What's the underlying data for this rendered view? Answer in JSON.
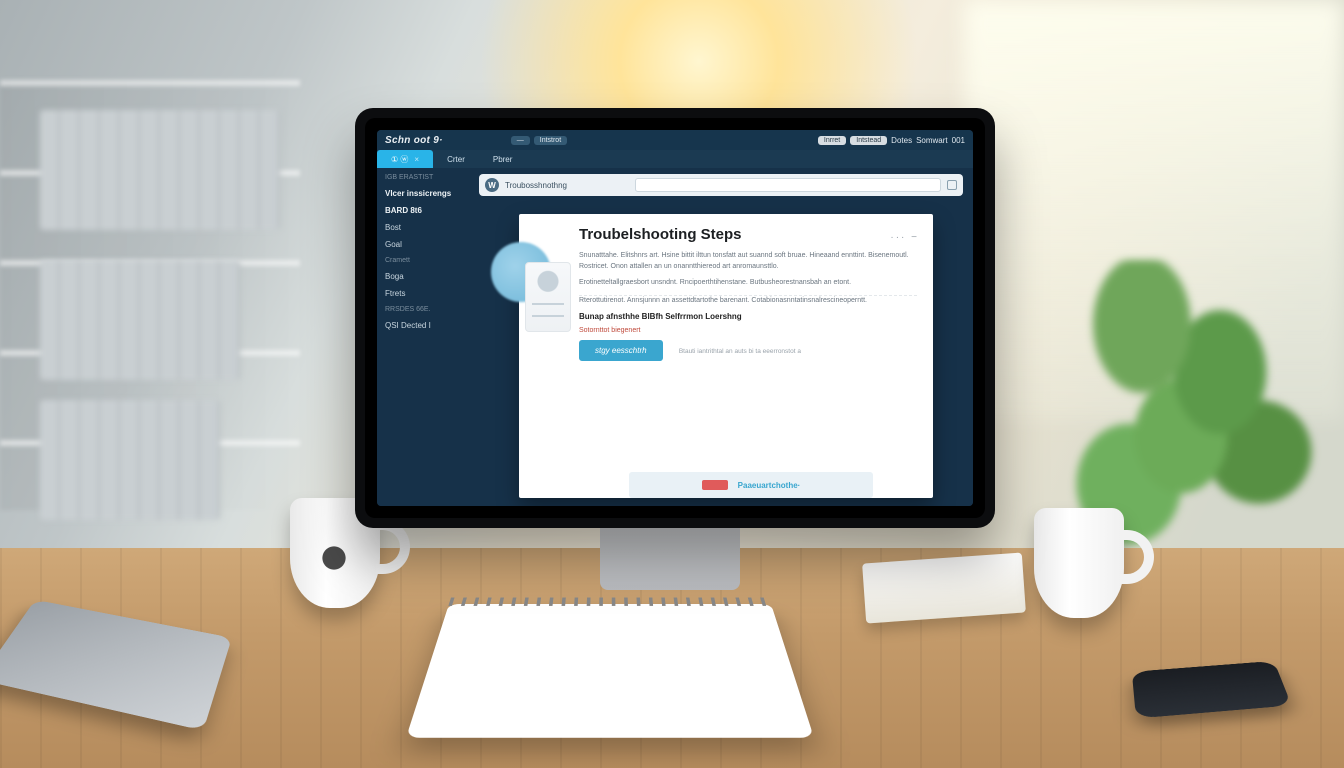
{
  "header": {
    "brand": "Schn oot 9·",
    "chips": [
      "—",
      "Intstrot"
    ],
    "right_pills": [
      "Inrret",
      "Intstead"
    ],
    "right_links": [
      "Dotes",
      "Somwart",
      "001"
    ]
  },
  "tabs": [
    {
      "label": "① ⓦ",
      "active": true
    },
    {
      "label": "Crter",
      "active": false
    },
    {
      "label": "Pbrer",
      "active": false
    }
  ],
  "sidebar": {
    "items": [
      {
        "label": "IGB ERASTIST",
        "variant": "dim"
      },
      {
        "label": "Vlcer inssicrengs",
        "variant": "strong"
      },
      {
        "label": "BARD 8t6",
        "variant": "strong"
      },
      {
        "label": "Bost",
        "variant": ""
      },
      {
        "label": "Goal",
        "variant": ""
      },
      {
        "label": "Cramett",
        "variant": "dim"
      },
      {
        "label": "Boga",
        "variant": ""
      },
      {
        "label": "Ftrets",
        "variant": ""
      },
      {
        "label": "RRSDES 66E.",
        "variant": "dim"
      },
      {
        "label": "QSI Dected I",
        "variant": ""
      }
    ]
  },
  "urlbar": {
    "icon_text": "W",
    "path": "Troubosshnothng",
    "placeholder": ""
  },
  "article": {
    "title": "Troubelshooting Steps",
    "more": "···  −",
    "p1": "Snunatttahe. Elitshnrs art. Hsine bittit ilttun tonsfatt aut suannd soft bruae. Hineaand ennttint. Bisenemoutl. Rostricet. Onon attallen an un onanntthiereod art anromaunsttlo.",
    "p2": "Erotinetteltallgraesbort unsndnt. Rncipoerthtihenstane. Butbusheorestnansbah an etont.",
    "p3": "Rterottutirenot. Annsjunnn an assettdtartothe barenant. Cotabionasnntatinsnalrescineoperntt.",
    "subheading": "Bunap afnsthhe BlBfh Selfrrmon Loershng",
    "link": "Sotornttot biegenert",
    "cta": "stgy eesschtrh",
    "aside": "Btauti iantrithtal an auts bi ta eeerronstot a"
  },
  "footer": {
    "link": "Paaeuartchothe·"
  }
}
